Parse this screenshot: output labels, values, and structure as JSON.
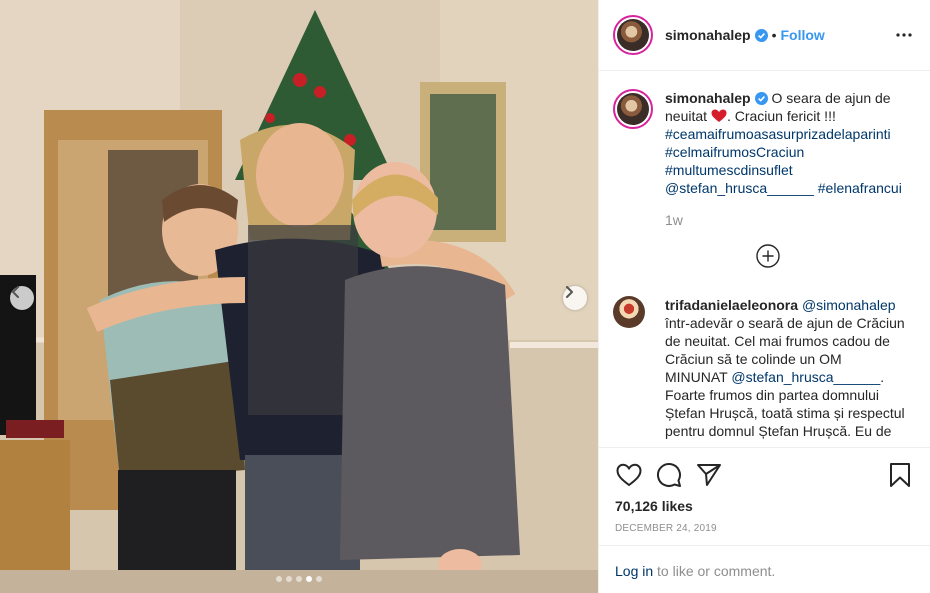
{
  "post": {
    "username": "simonahalep",
    "follow_label": "Follow",
    "bullet": "•",
    "caption_text": "O seara de ajun de neuitat",
    "caption_after_heart": ". Craciun fericit !!!",
    "hashtags": [
      "#ceamaifrumoasasurprizadelaparinti",
      "#celmaifrumosCraciun",
      "#multumescdinsuflet"
    ],
    "mention": "@stefan_hrusca______",
    "last_tag": "#elenafrancui",
    "time_ago": "1w",
    "likes": "70,126 likes",
    "date": "DECEMBER 24, 2019"
  },
  "comment": {
    "username": "trifadanielaeleonora",
    "mention": "@simonahalep",
    "text_part1": "într-adevăr o seară de ajun de Crăciun de neuitat. Cel mai frumos cadou de Crăciun să te colinde un OM MINUNAT",
    "mention2": "@stefan_hrusca______",
    "text_part2": ". Foarte frumos din partea domnului Ștefan Hrușcă, toată stima și respectul pentru domnul Ștefan Hrușcă. Eu de"
  },
  "login": {
    "link_label": "Log in",
    "rest": " to like or comment."
  },
  "icons": {
    "verified": "verified-badge-icon",
    "more": "more-options-icon",
    "load_more": "load-more-comments-icon",
    "like": "heart-icon",
    "comment": "comment-icon",
    "share": "share-icon",
    "save": "bookmark-icon",
    "prev": "chevron-left-icon",
    "next": "chevron-right-icon"
  },
  "carousel": {
    "count": 5,
    "active_index": 3
  },
  "colors": {
    "link_blue": "#3897f0",
    "tag_blue": "#00376b",
    "heart_red": "#ed4956",
    "muted": "#8e8e8e"
  }
}
